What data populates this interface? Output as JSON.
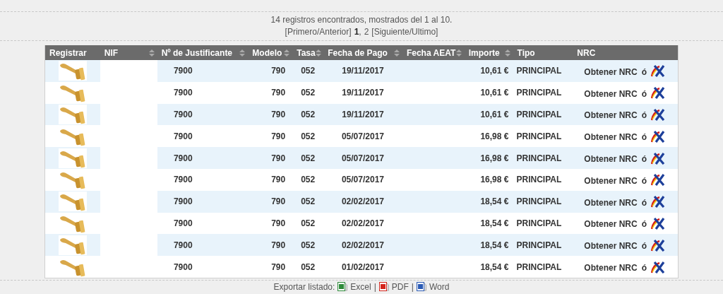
{
  "summary": "14 registros encontrados, mostrados del 1 al 10.",
  "pagination": {
    "first_prev": "[Primero/Anterior]",
    "pages": [
      {
        "label": "1",
        "selected": true
      },
      {
        "label": "2",
        "selected": false
      }
    ],
    "next_last": "[Siguiente/Ultimo]",
    "separator": ","
  },
  "table": {
    "columns": [
      {
        "label": "Registrar",
        "sortable": false
      },
      {
        "label": "NIF",
        "sortable": true
      },
      {
        "label": "Nº de Justificante",
        "sortable": true
      },
      {
        "label": "Modelo",
        "sortable": true
      },
      {
        "label": "Tasa",
        "sortable": true
      },
      {
        "label": "Fecha de Pago",
        "sortable": true
      },
      {
        "label": "Fecha AEAT",
        "sortable": true
      },
      {
        "label": "Importe",
        "sortable": true
      },
      {
        "label": "Tipo",
        "sortable": false
      },
      {
        "label": "NRC",
        "sortable": false
      }
    ],
    "rows": [
      {
        "justificante": "7900",
        "modelo": "790",
        "tasa": "052",
        "fecha_pago": "19/11/2017",
        "importe": "10,61 €",
        "tipo": "PRINCIPAL",
        "nrc_link": "Obtener NRC",
        "or": "ó"
      },
      {
        "justificante": "7900",
        "modelo": "790",
        "tasa": "052",
        "fecha_pago": "19/11/2017",
        "importe": "10,61 €",
        "tipo": "PRINCIPAL",
        "nrc_link": "Obtener NRC",
        "or": "ó"
      },
      {
        "justificante": "7900",
        "modelo": "790",
        "tasa": "052",
        "fecha_pago": "19/11/2017",
        "importe": "10,61 €",
        "tipo": "PRINCIPAL",
        "nrc_link": "Obtener NRC",
        "or": "ó"
      },
      {
        "justificante": "7900",
        "modelo": "790",
        "tasa": "052",
        "fecha_pago": "05/07/2017",
        "importe": "16,98 €",
        "tipo": "PRINCIPAL",
        "nrc_link": "Obtener NRC",
        "or": "ó"
      },
      {
        "justificante": "7900",
        "modelo": "790",
        "tasa": "052",
        "fecha_pago": "05/07/2017",
        "importe": "16,98 €",
        "tipo": "PRINCIPAL",
        "nrc_link": "Obtener NRC",
        "or": "ó"
      },
      {
        "justificante": "7900",
        "modelo": "790",
        "tasa": "052",
        "fecha_pago": "05/07/2017",
        "importe": "16,98 €",
        "tipo": "PRINCIPAL",
        "nrc_link": "Obtener NRC",
        "or": "ó"
      },
      {
        "justificante": "7900",
        "modelo": "790",
        "tasa": "052",
        "fecha_pago": "02/02/2017",
        "importe": "18,54 €",
        "tipo": "PRINCIPAL",
        "nrc_link": "Obtener NRC",
        "or": "ó"
      },
      {
        "justificante": "7900",
        "modelo": "790",
        "tasa": "052",
        "fecha_pago": "02/02/2017",
        "importe": "18,54 €",
        "tipo": "PRINCIPAL",
        "nrc_link": "Obtener NRC",
        "or": "ó"
      },
      {
        "justificante": "7900",
        "modelo": "790",
        "tasa": "052",
        "fecha_pago": "02/02/2017",
        "importe": "18,54 €",
        "tipo": "PRINCIPAL",
        "nrc_link": "Obtener NRC",
        "or": "ó"
      },
      {
        "justificante": "7900",
        "modelo": "790",
        "tasa": "052",
        "fecha_pago": "01/02/2017",
        "importe": "18,54 €",
        "tipo": "PRINCIPAL",
        "nrc_link": "Obtener NRC",
        "or": "ó"
      }
    ]
  },
  "export": {
    "label": "Exportar listado:",
    "links": [
      {
        "kind": "excel",
        "label": "Excel"
      },
      {
        "kind": "pdf",
        "label": "PDF"
      },
      {
        "kind": "word",
        "label": "Word"
      }
    ],
    "separator": "|"
  }
}
